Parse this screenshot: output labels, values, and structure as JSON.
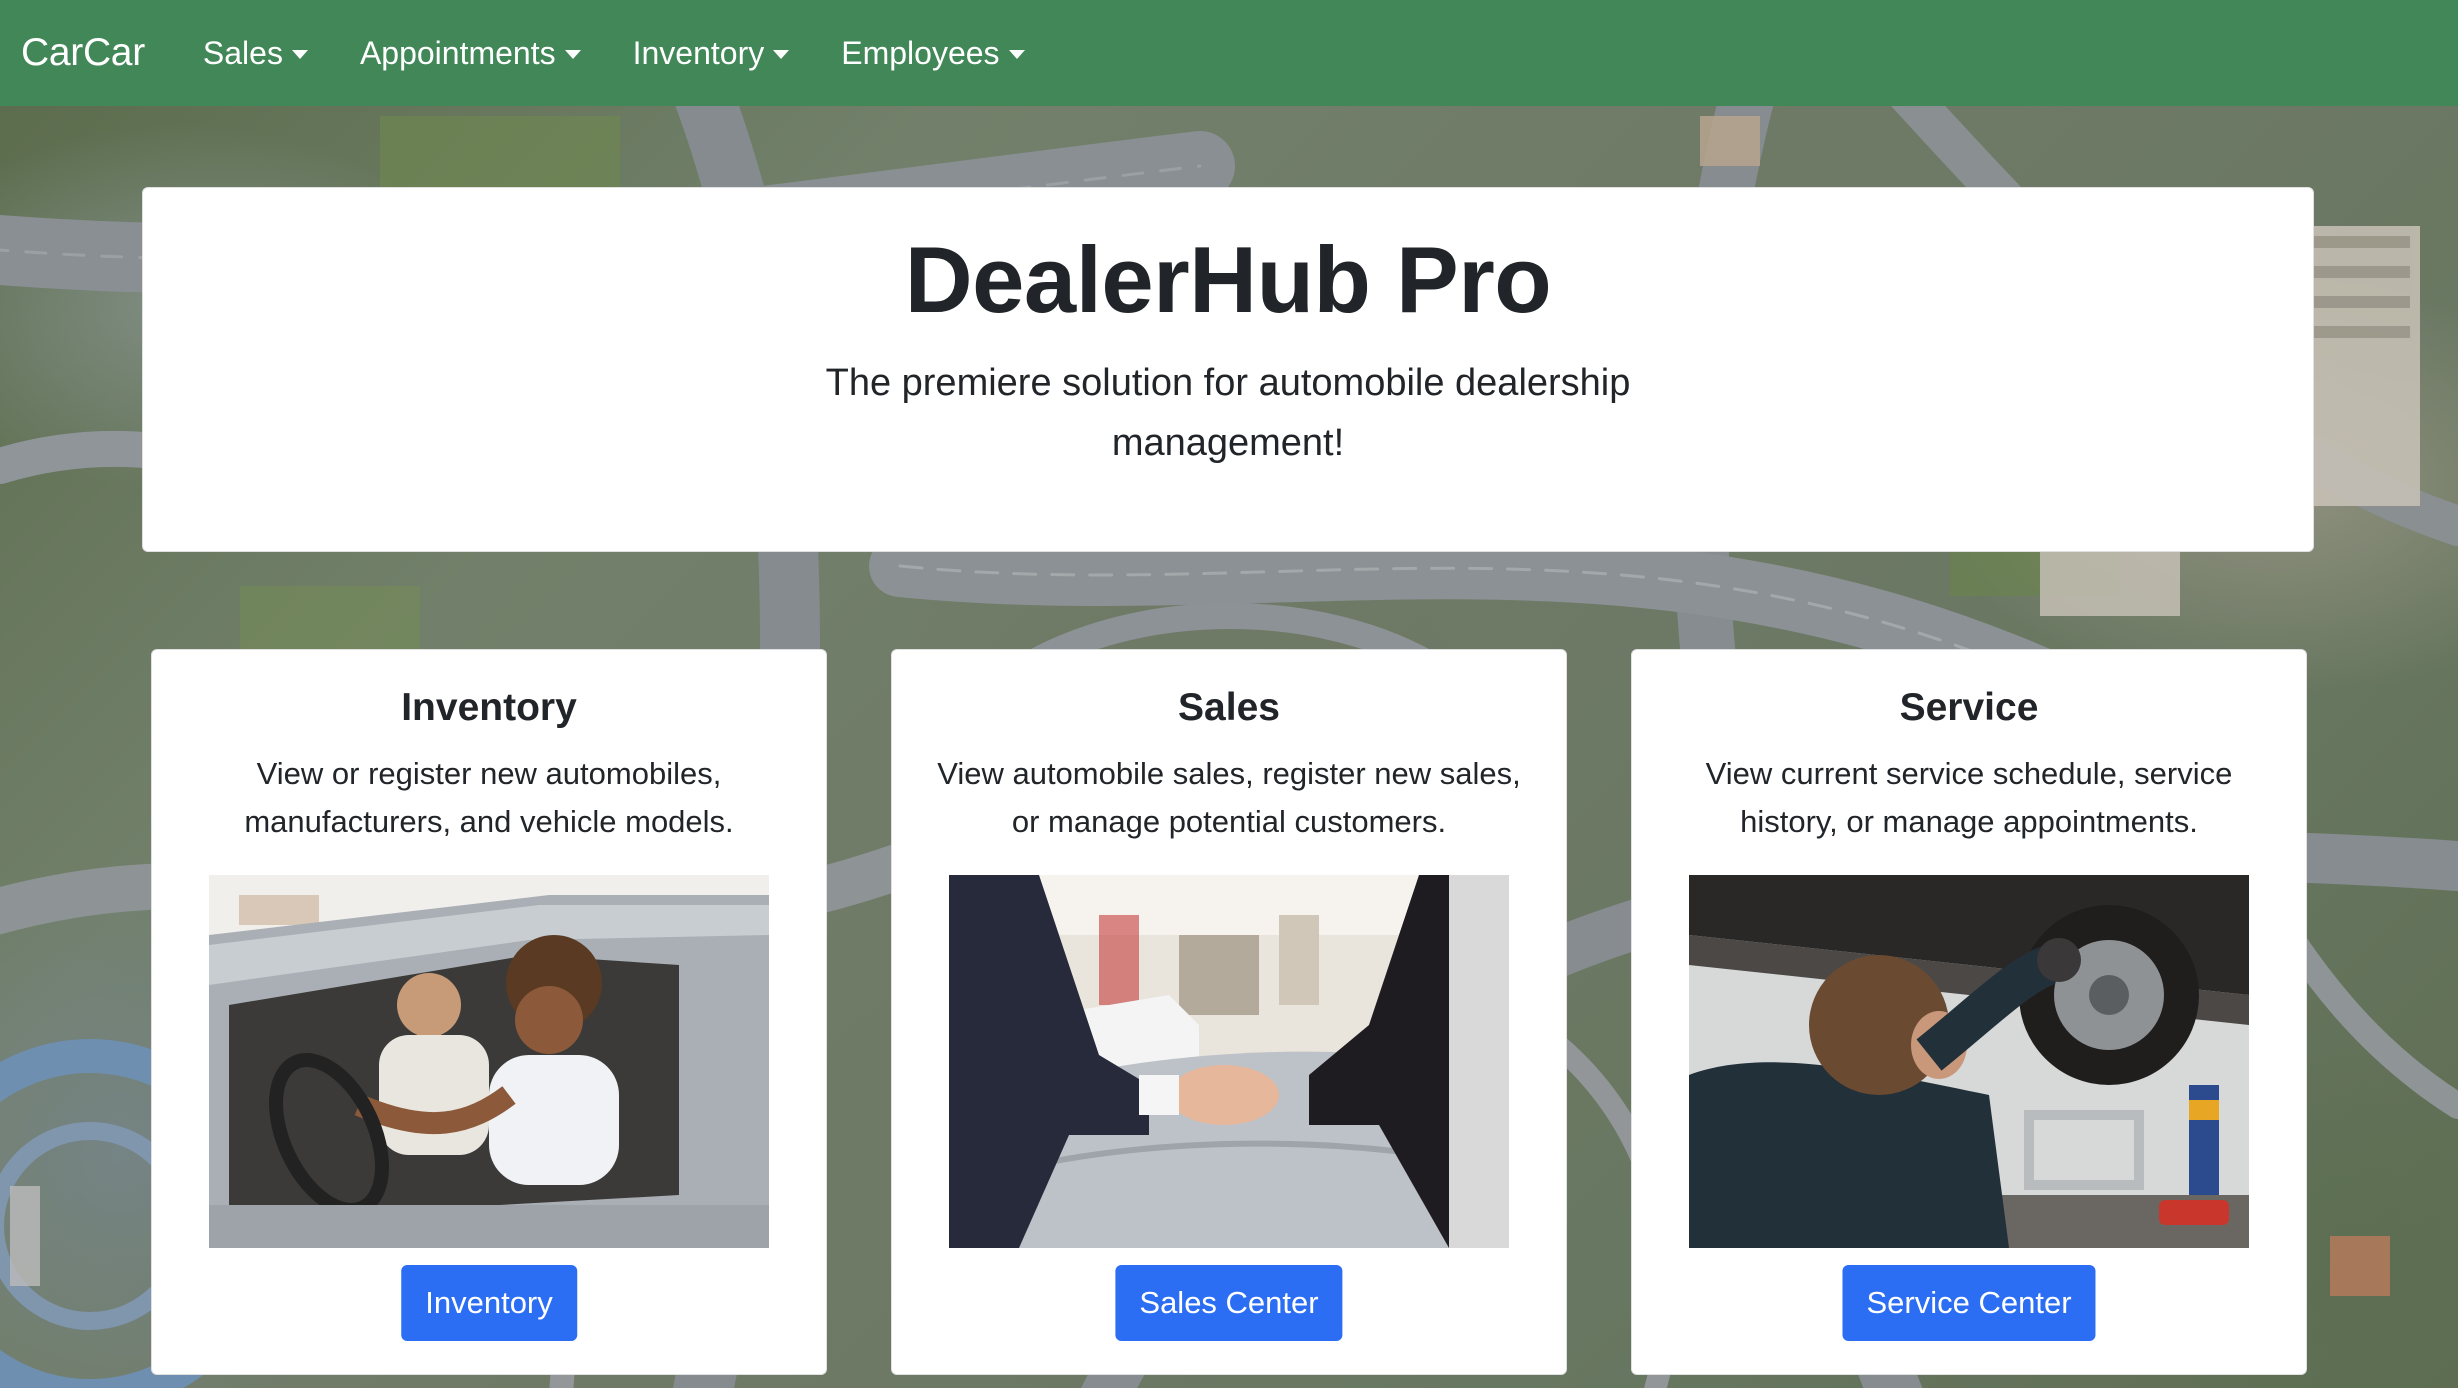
{
  "navbar": {
    "brand": "CarCar",
    "items": [
      {
        "label": "Sales"
      },
      {
        "label": "Appointments"
      },
      {
        "label": "Inventory"
      },
      {
        "label": "Employees"
      }
    ],
    "color": "#418757"
  },
  "hero": {
    "title": "DealerHub Pro",
    "subtitle": "The premiere solution for automobile dealership management!"
  },
  "cards": [
    {
      "title": "Inventory",
      "text": "View or register new automobiles, manufacturers, and vehicle models.",
      "image": "woman-driving-car-photo",
      "button": "Inventory"
    },
    {
      "title": "Sales",
      "text": "View automobile sales, register new sales, or manage potential customers.",
      "image": "handshake-showroom-photo",
      "button": "Sales Center"
    },
    {
      "title": "Service",
      "text": "View current service schedule, service history, or manage appointments.",
      "image": "mechanic-under-car-photo",
      "button": "Service Center"
    }
  ],
  "accent_color": "#2c6ef3"
}
